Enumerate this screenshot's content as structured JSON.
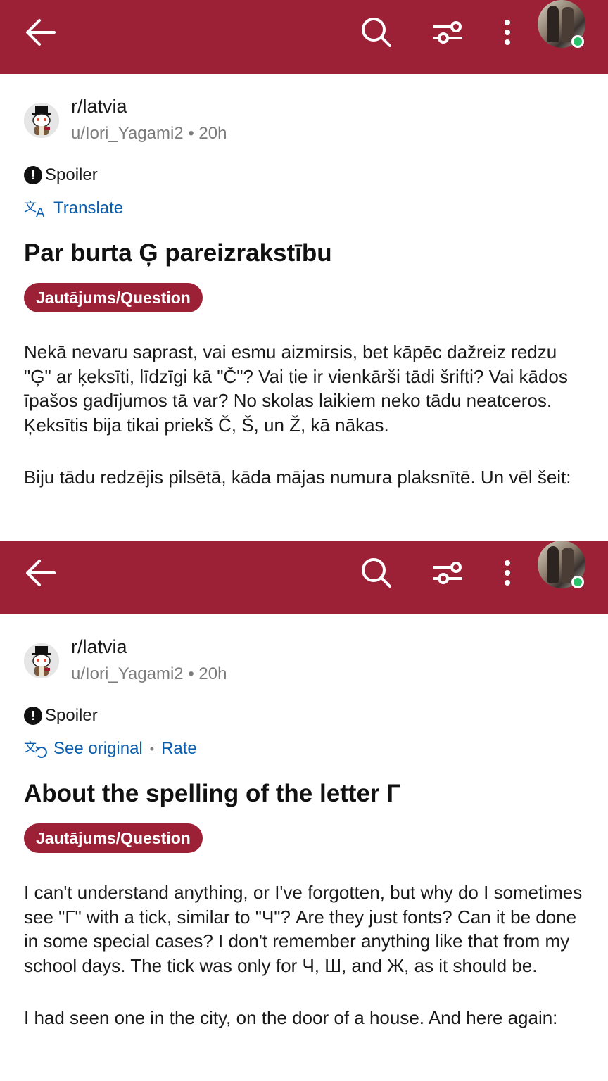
{
  "colors": {
    "header_bg": "#9c2136",
    "flair_bg": "#9c2136",
    "link": "#0b5dad",
    "online": "#27c26a"
  },
  "screens": [
    {
      "header": {
        "back_icon": "arrow-left-icon",
        "search_icon": "search-icon",
        "filter_icon": "sliders-icon",
        "more_icon": "more-vertical-icon"
      },
      "post": {
        "subreddit": "r/latvia",
        "author": "u/Iori_Yagami2",
        "time": "20h",
        "spoiler": "Spoiler",
        "translate_link": "Translate",
        "rate_link": "",
        "title": "Par burta Ģ pareizrakstību",
        "flair": "Jautājums/Question",
        "paragraphs": [
          "Nekā nevaru saprast, vai esmu aizmirsis, bet kāpēc dažreiz redzu \"Ģ\" ar ķeksīti, līdzīgi kā \"Č\"? Vai tie ir vienkārši tādi šrifti? Vai kādos īpašos gadījumos tā var? No skolas laikiem neko tādu neatceros. Ķeksītis bija tikai priekš Č, Š, un Ž, kā nākas.",
          "Biju tādu redzējis pilsētā, kāda mājas numura plaksnītē. Un vēl šeit:"
        ]
      }
    },
    {
      "header": {
        "back_icon": "arrow-left-icon",
        "search_icon": "search-icon",
        "filter_icon": "sliders-icon",
        "more_icon": "more-vertical-icon"
      },
      "post": {
        "subreddit": "r/latvia",
        "author": "u/Iori_Yagami2",
        "time": "20h",
        "spoiler": "Spoiler",
        "translate_link": "See original",
        "rate_link": "Rate",
        "title": "About the spelling of the letter Г",
        "flair": "Jautājums/Question",
        "paragraphs": [
          "I can't understand anything, or I've forgotten, but why do I sometimes see \"Г\" with a tick, similar to \"Ч\"? Are they just fonts? Can it be done in some special cases? I don't remember anything like that from my school days. The tick was only for Ч, Ш, and Ж, as it should be.",
          "I had seen one in the city, on the door of a house. And here again:"
        ]
      }
    }
  ]
}
